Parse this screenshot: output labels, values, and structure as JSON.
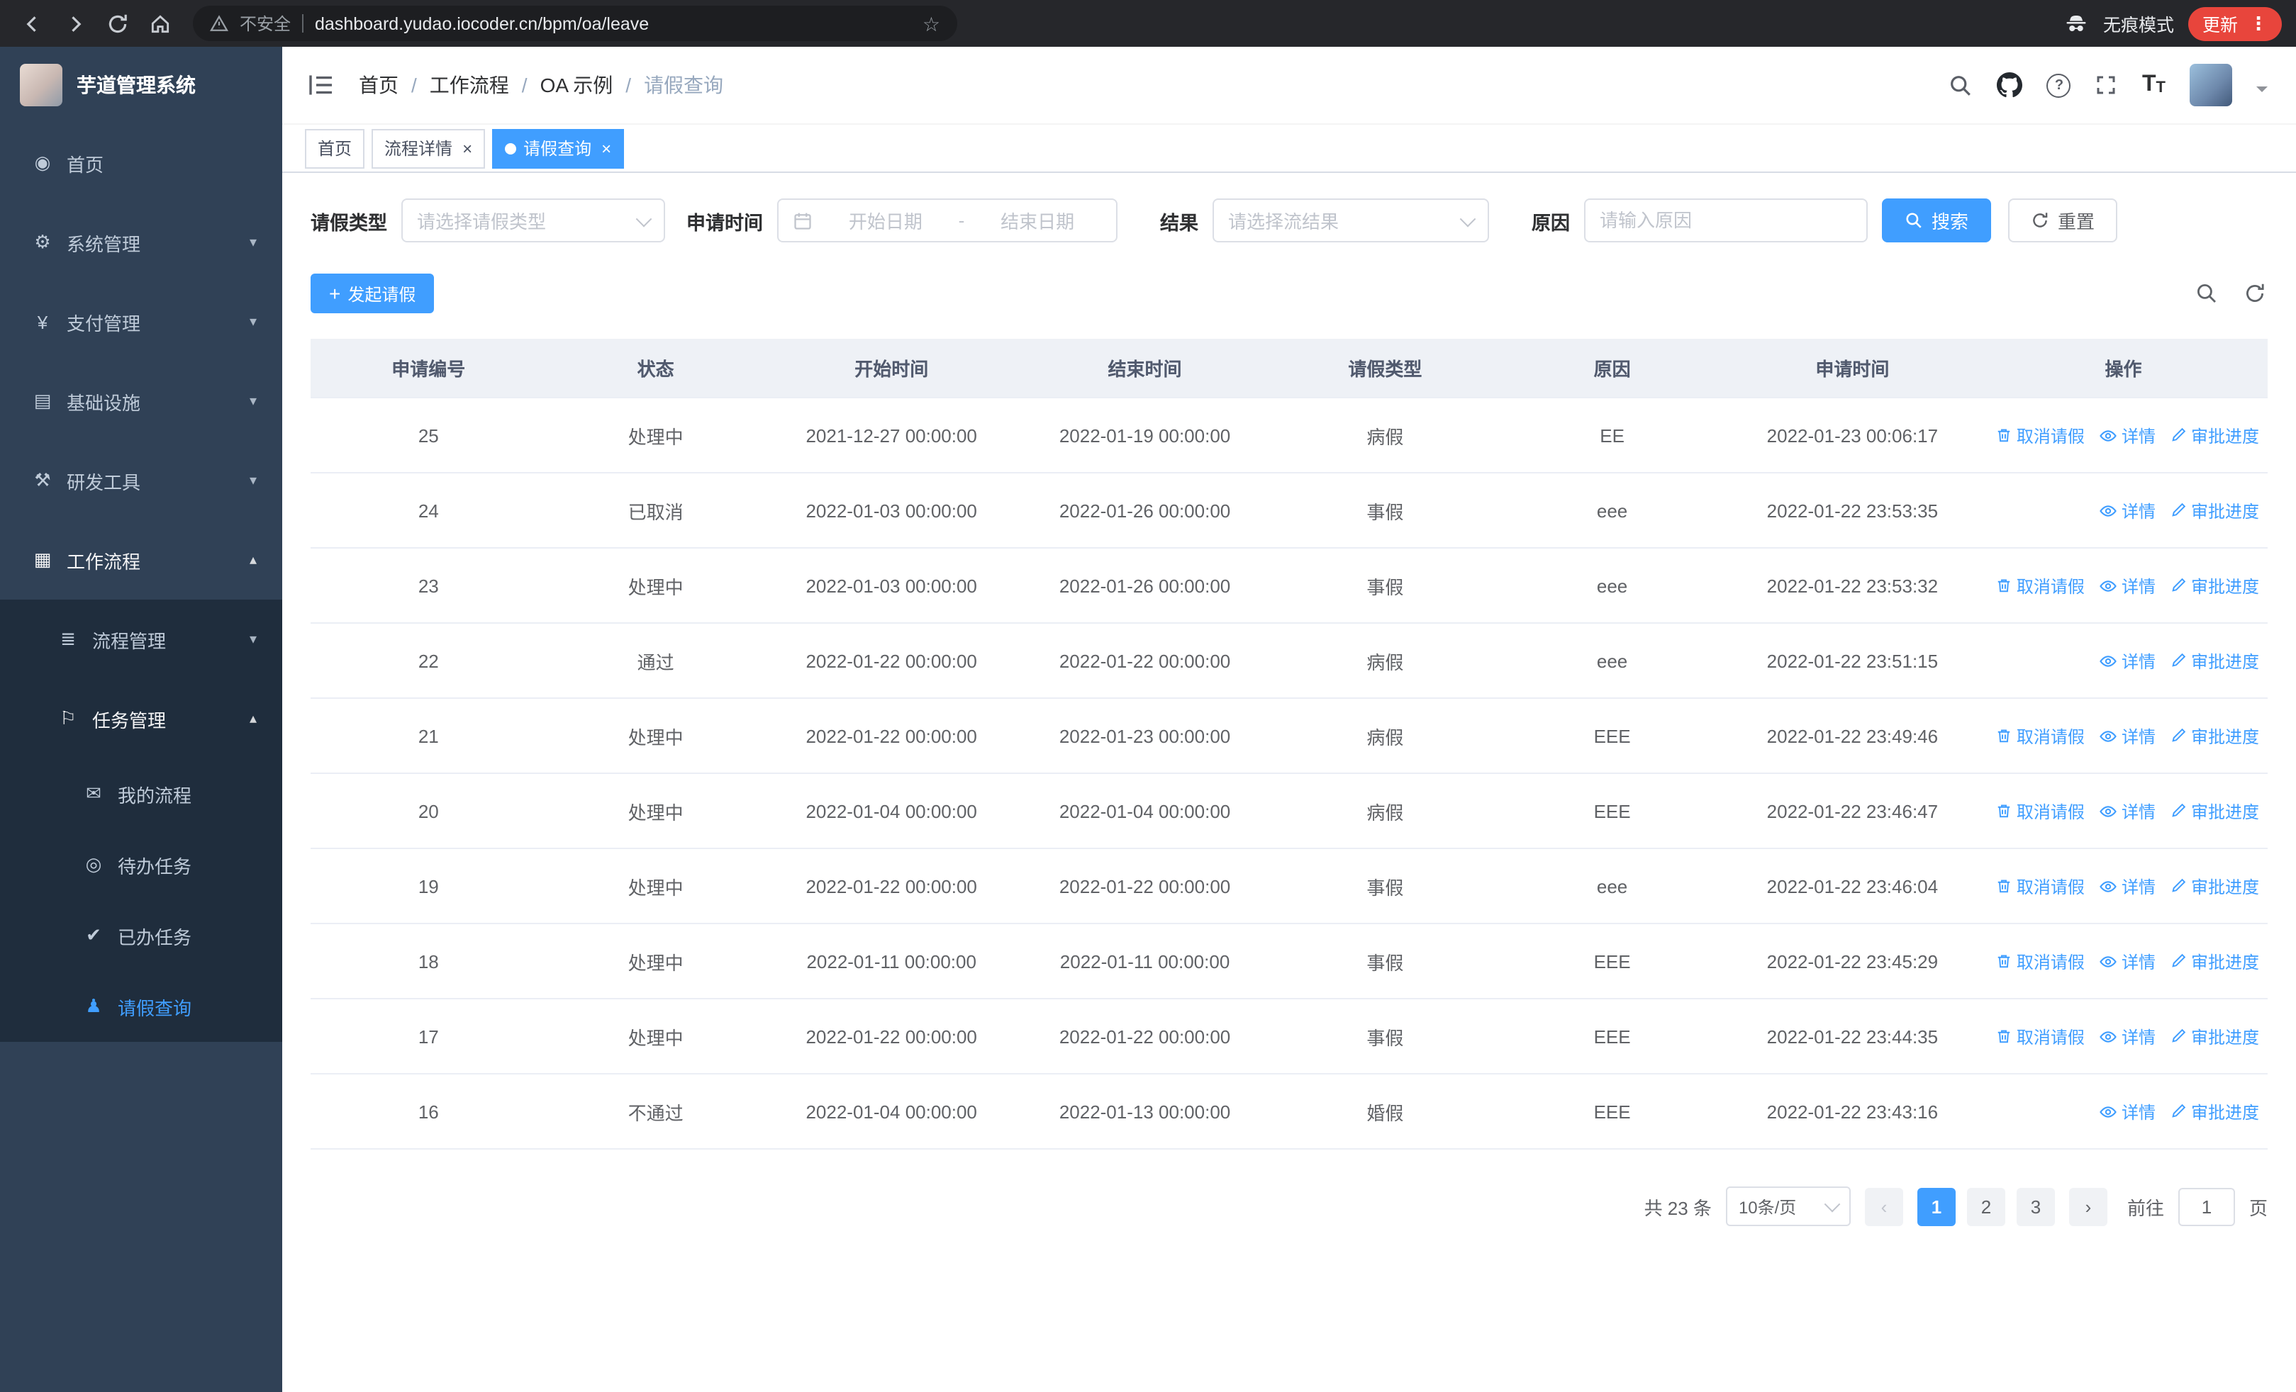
{
  "colors": {
    "accent": "#409eff",
    "sidebar_bg": "#304156",
    "submenu_bg": "#1f2d3d",
    "sidebar_text": "#bfcbd9",
    "chrome_bar": "#26272b",
    "update_badge": "#e8453c",
    "table_border": "#ebeef5",
    "table_header_bg": "#eef1f6",
    "text_primary": "#303133",
    "text_regular": "#606266",
    "text_placeholder": "#c0c4cc"
  },
  "browser": {
    "security_label": "不安全",
    "url": "dashboard.yudao.iocoder.cn/bpm/oa/leave",
    "star_glyph": "☆",
    "incognito_label": "无痕模式",
    "update_label": "更新",
    "menu_glyph": "⋮"
  },
  "app": {
    "logo_title": "芋道管理系统",
    "breadcrumb": [
      "首页",
      "工作流程",
      "OA 示例",
      "请假查询"
    ],
    "breadcrumb_separator": "/",
    "tab_close": "×",
    "tabs": [
      {
        "label": "首页",
        "closable": false,
        "active": false
      },
      {
        "label": "流程详情",
        "closable": true,
        "active": false
      },
      {
        "label": "请假查询",
        "closable": true,
        "active": true
      }
    ],
    "header": {
      "help_glyph": "?",
      "font_glyph": "T"
    }
  },
  "sidebar": {
    "items": [
      {
        "label": "首页",
        "icon": "dashboard-icon",
        "glyph": "◉",
        "level": 1
      },
      {
        "label": "系统管理",
        "icon": "gear-icon",
        "glyph": "⚙",
        "level": 1,
        "arrow": "▾"
      },
      {
        "label": "支付管理",
        "icon": "yen-icon",
        "glyph": "¥",
        "level": 1,
        "arrow": "▾"
      },
      {
        "label": "基础设施",
        "icon": "infrastructure-icon",
        "glyph": "▤",
        "level": 1,
        "arrow": "▾"
      },
      {
        "label": "研发工具",
        "icon": "tools-icon",
        "glyph": "⚒",
        "level": 1,
        "arrow": "▾"
      },
      {
        "label": "工作流程",
        "icon": "workflow-icon",
        "glyph": "▦",
        "level": 1,
        "arrow": "▴",
        "open": true
      },
      {
        "label": "流程管理",
        "icon": "process-list-icon",
        "glyph": "≣",
        "level": 2,
        "arrow": "▾"
      },
      {
        "label": "任务管理",
        "icon": "task-flag-icon",
        "glyph": "⚐",
        "level": 2,
        "arrow": "▴",
        "open": true
      },
      {
        "label": "我的流程",
        "icon": "message-icon",
        "glyph": "✉",
        "level": 3
      },
      {
        "label": "待办任务",
        "icon": "eye-icon",
        "glyph": "◎",
        "level": 3
      },
      {
        "label": "已办任务",
        "icon": "done-icon",
        "glyph": "✔",
        "level": 3
      },
      {
        "label": "请假查询",
        "icon": "user-icon",
        "glyph": "♟",
        "level": 3,
        "active": true
      }
    ]
  },
  "filters": {
    "leave_type": {
      "label": "请假类型",
      "placeholder": "请选择请假类型"
    },
    "apply_time": {
      "label": "申请时间",
      "start_placeholder": "开始日期",
      "separator": "-",
      "end_placeholder": "结束日期"
    },
    "result": {
      "label": "结果",
      "placeholder": "请选择流结果"
    },
    "reason": {
      "label": "原因",
      "placeholder": "请输入原因"
    },
    "search_label": "搜索",
    "reset_label": "重置"
  },
  "toolbar": {
    "plus_glyph": "+",
    "create_label": "发起请假"
  },
  "table": {
    "columns": [
      "申请编号",
      "状态",
      "开始时间",
      "结束时间",
      "请假类型",
      "原因",
      "申请时间",
      "操作"
    ],
    "action_labels": {
      "cancel": "取消请假",
      "detail": "详情",
      "progress": "审批进度"
    },
    "rows": [
      {
        "id": "25",
        "status": "处理中",
        "start": "2021-12-27 00:00:00",
        "end": "2022-01-19 00:00:00",
        "type": "病假",
        "reason": "EE",
        "applied": "2022-01-23 00:06:17",
        "can_cancel": true
      },
      {
        "id": "24",
        "status": "已取消",
        "start": "2022-01-03 00:00:00",
        "end": "2022-01-26 00:00:00",
        "type": "事假",
        "reason": "eee",
        "applied": "2022-01-22 23:53:35",
        "can_cancel": false
      },
      {
        "id": "23",
        "status": "处理中",
        "start": "2022-01-03 00:00:00",
        "end": "2022-01-26 00:00:00",
        "type": "事假",
        "reason": "eee",
        "applied": "2022-01-22 23:53:32",
        "can_cancel": true
      },
      {
        "id": "22",
        "status": "通过",
        "start": "2022-01-22 00:00:00",
        "end": "2022-01-22 00:00:00",
        "type": "病假",
        "reason": "eee",
        "applied": "2022-01-22 23:51:15",
        "can_cancel": false
      },
      {
        "id": "21",
        "status": "处理中",
        "start": "2022-01-22 00:00:00",
        "end": "2022-01-23 00:00:00",
        "type": "病假",
        "reason": "EEE",
        "applied": "2022-01-22 23:49:46",
        "can_cancel": true
      },
      {
        "id": "20",
        "status": "处理中",
        "start": "2022-01-04 00:00:00",
        "end": "2022-01-04 00:00:00",
        "type": "病假",
        "reason": "EEE",
        "applied": "2022-01-22 23:46:47",
        "can_cancel": true
      },
      {
        "id": "19",
        "status": "处理中",
        "start": "2022-01-22 00:00:00",
        "end": "2022-01-22 00:00:00",
        "type": "事假",
        "reason": "eee",
        "applied": "2022-01-22 23:46:04",
        "can_cancel": true,
        "hover": true
      },
      {
        "id": "18",
        "status": "处理中",
        "start": "2022-01-11 00:00:00",
        "end": "2022-01-11 00:00:00",
        "type": "事假",
        "reason": "EEE",
        "applied": "2022-01-22 23:45:29",
        "can_cancel": true
      },
      {
        "id": "17",
        "status": "处理中",
        "start": "2022-01-22 00:00:00",
        "end": "2022-01-22 00:00:00",
        "type": "事假",
        "reason": "EEE",
        "applied": "2022-01-22 23:44:35",
        "can_cancel": true
      },
      {
        "id": "16",
        "status": "不通过",
        "start": "2022-01-04 00:00:00",
        "end": "2022-01-13 00:00:00",
        "type": "婚假",
        "reason": "EEE",
        "applied": "2022-01-22 23:43:16",
        "can_cancel": false
      }
    ]
  },
  "pagination": {
    "total_label": "共 23 条",
    "page_size": "10条/页",
    "prev_glyph": "‹",
    "next_glyph": "›",
    "pages": [
      {
        "num": "1",
        "active": true
      },
      {
        "num": "2"
      },
      {
        "num": "3"
      }
    ],
    "goto_label": "前往",
    "goto_value": "1",
    "goto_suffix": "页"
  }
}
